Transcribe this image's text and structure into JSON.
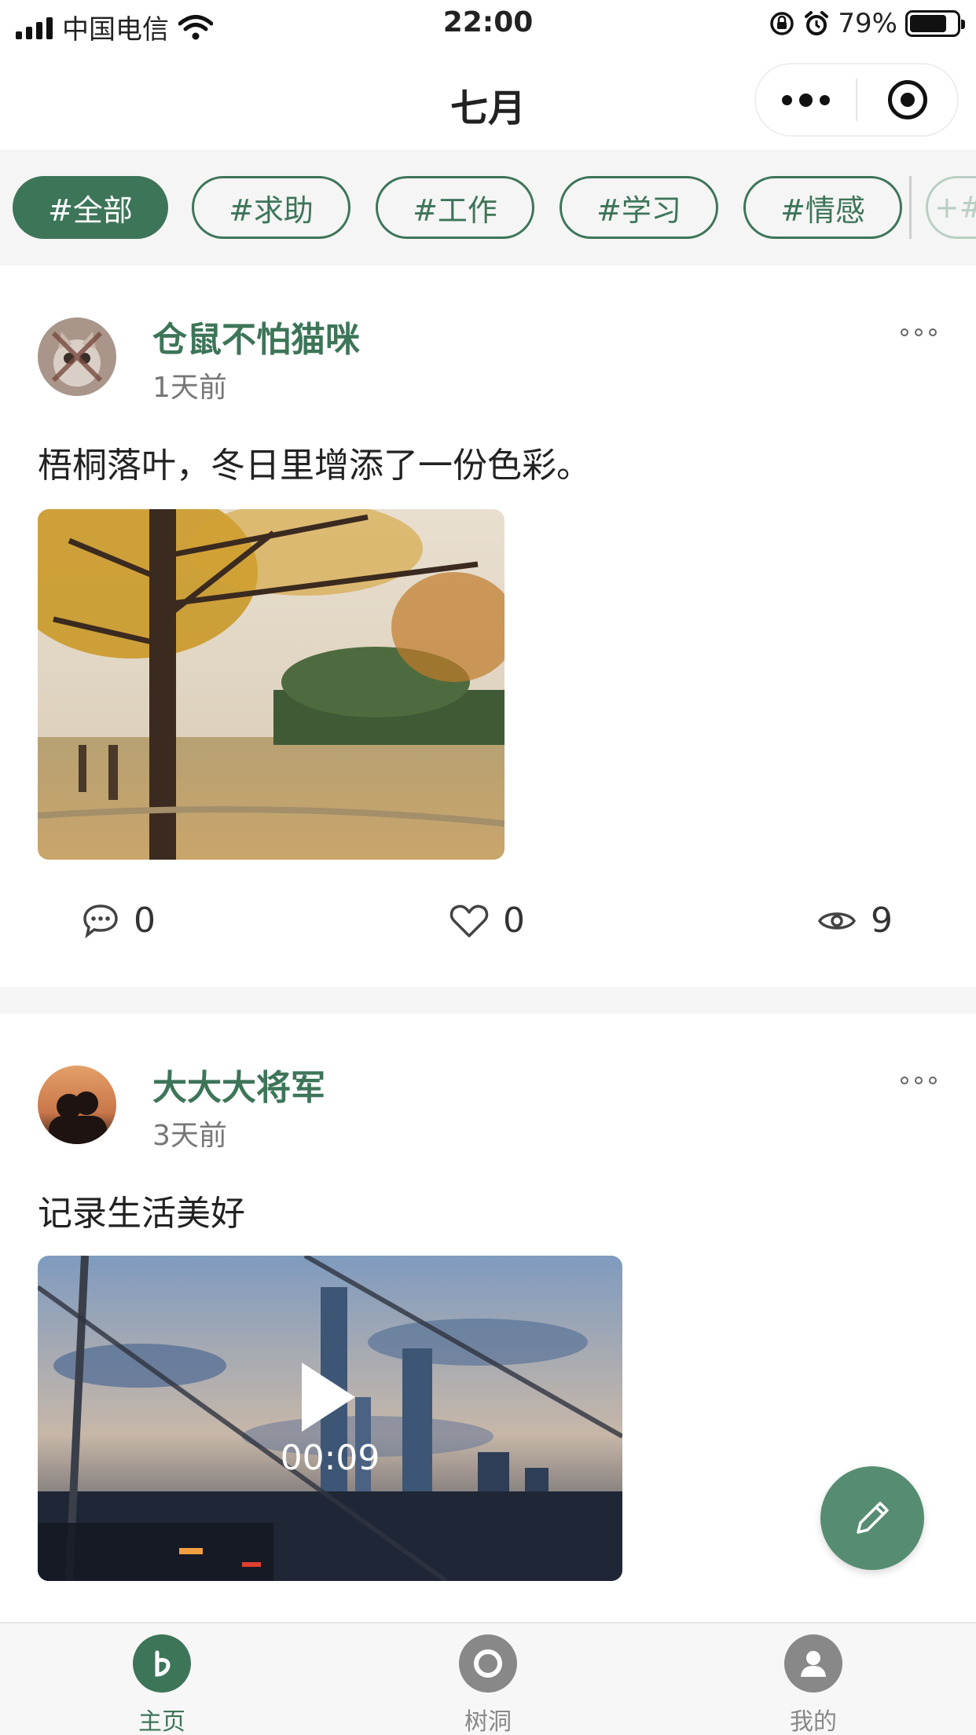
{
  "status_bar": {
    "carrier": "中国电信",
    "time": "22:00",
    "battery": "79%",
    "battery_level": 0.79
  },
  "nav": {
    "title": "七月"
  },
  "tags": [
    "#全部",
    "#求助",
    "#工作",
    "#学习",
    "#情感",
    "+#"
  ],
  "posts": [
    {
      "author": "仓鼠不怕猫咪",
      "time": "1天前",
      "content": "梧桐落叶，冬日里增添了一份色彩。",
      "comments": "0",
      "likes": "0",
      "views": "9"
    },
    {
      "author": "大大大将军",
      "time": "3天前",
      "content": "记录生活美好",
      "video_duration": "00:09"
    }
  ],
  "tabs": [
    {
      "label": "主页"
    },
    {
      "label": "树洞"
    },
    {
      "label": "我的"
    }
  ],
  "colors": {
    "accent": "#3d7559",
    "fab": "#568d72"
  }
}
